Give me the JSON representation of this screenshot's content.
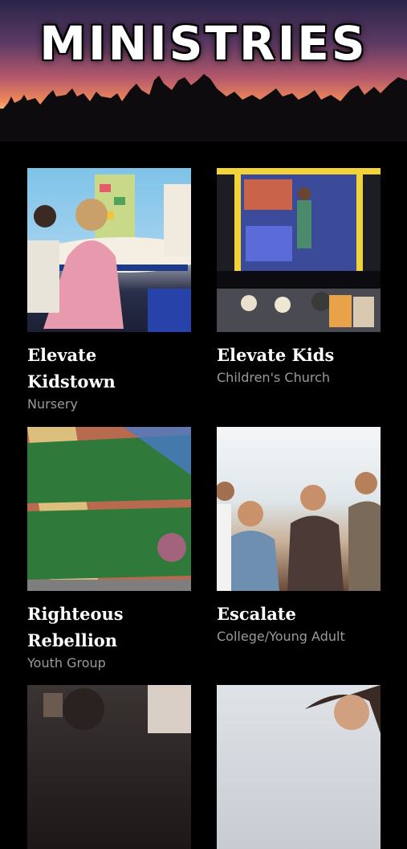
{
  "header": {
    "title": "MINISTRIES"
  },
  "ministries": [
    {
      "title_line1": "Elevate",
      "title_line2": "Kidstown",
      "subtitle": "Nursery",
      "image": "nursery-photo"
    },
    {
      "title_line1": "Elevate Kids",
      "title_line2": "",
      "subtitle": "Children's Church",
      "image": "kids-stage-photo"
    },
    {
      "title_line1": "Righteous",
      "title_line2": "Rebellion",
      "subtitle": "Youth Group",
      "image": "graffiti-photo"
    },
    {
      "title_line1": "Escalate",
      "title_line2": "",
      "subtitle": "College/Young Adult",
      "image": "young-adults-photo"
    }
  ],
  "colors": {
    "background": "#000000",
    "subtitle": "#9a9a9a",
    "title": "#ffffff"
  }
}
